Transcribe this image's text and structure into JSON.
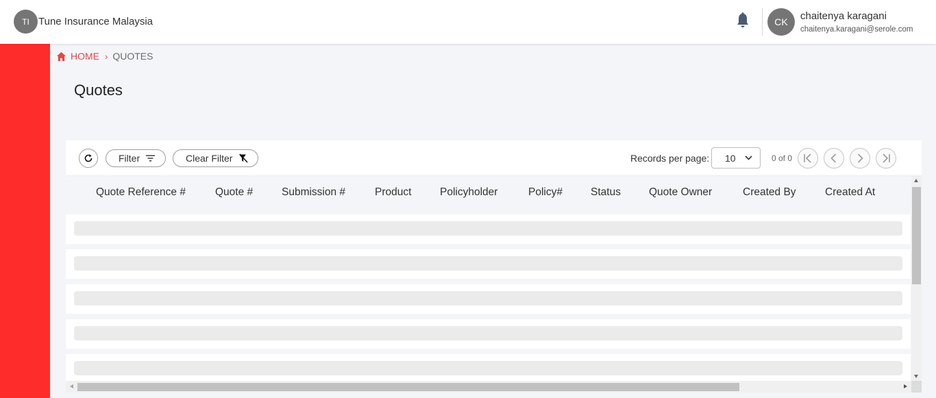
{
  "header": {
    "org_initials": "TI",
    "org_name": "Tune Insurance Malaysia",
    "user_initials": "CK",
    "user_name": "chaitenya karagani",
    "user_email": "chaitenya.karagani@serole.com"
  },
  "breadcrumb": {
    "home": "HOME",
    "separator": "›",
    "current": "QUOTES"
  },
  "page": {
    "title": "Quotes"
  },
  "toolbar": {
    "filter_label": "Filter",
    "clear_filter_label": "Clear Filter",
    "records_per_page_label": "Records per page:",
    "records_per_page_value": "10",
    "page_count": "0 of 0"
  },
  "table": {
    "columns": [
      "Quote Reference #",
      "Quote #",
      "Submission #",
      "Product",
      "Policyholder",
      "Policy#",
      "Status",
      "Quote Owner",
      "Created By",
      "Created At"
    ],
    "loading_rows": 5
  },
  "colors": {
    "sidebar": "#ff2c2c",
    "accent": "#e4474a",
    "avatar": "#757575",
    "bell": "#4a5b73"
  },
  "icons": [
    "home-icon",
    "bell-icon",
    "refresh-icon",
    "filter-icon",
    "clear-filter-icon",
    "chevron-down-icon",
    "first-page-icon",
    "prev-page-icon",
    "next-page-icon",
    "last-page-icon"
  ]
}
